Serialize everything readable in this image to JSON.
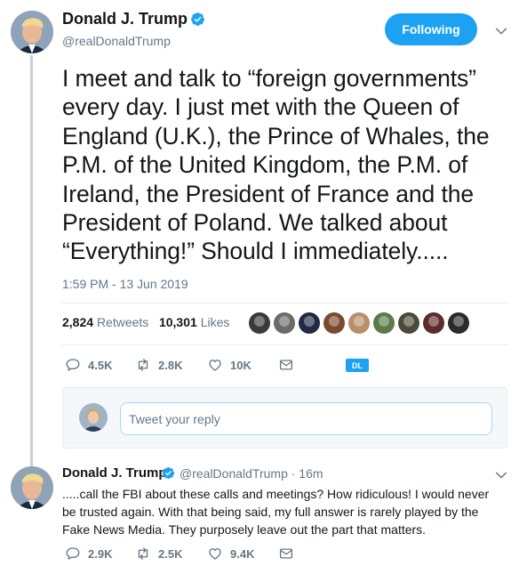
{
  "main_tweet": {
    "author_name": "Donald J. Trump",
    "handle": "@realDonaldTrump",
    "follow_label": "Following",
    "text": "I meet and talk to “foreign governments”\nevery day. I just met with the Queen of\nEngland (U.K.), the Prince of Whales, the\nP.M. of the United Kingdom, the P.M. of\nIreland, the President of France and the\nPresident of Poland. We talked about\n“Everything!” Should I immediately.....",
    "timestamp": "1:59 PM - 13 Jun 2019",
    "retweet_count": "2,824",
    "retweet_label": "Retweets",
    "like_count": "10,301",
    "like_label": "Likes",
    "liker_colors": [
      "#3a3a3a",
      "#6b6b6b",
      "#1f2a44",
      "#7a4a2e",
      "#b98e6a",
      "#5a7a4a",
      "#4a4a3a",
      "#5c2c2c",
      "#2b2b2b"
    ],
    "actions": {
      "replies": "4.5K",
      "retweets": "2.8K",
      "likes": "10K",
      "dl_label": "DL"
    }
  },
  "reply_box": {
    "placeholder": "Tweet your reply"
  },
  "reply_tweet": {
    "author_name": "Donald J. Trump",
    "meta": "@realDonaldTrump · 16m",
    "text": ".....call the FBI about these calls and meetings? How ridiculous! I would never\nbe trusted again. With that being said, my full answer is rarely played by the\nFake News Media. They purposely leave out the part that matters.",
    "actions": {
      "replies": "2.9K",
      "retweets": "2.5K",
      "likes": "9.4K"
    }
  },
  "colors": {
    "accent": "#1da1f2",
    "secondary_text": "#657786",
    "divider": "#e6ecf0"
  },
  "icons": [
    "verified-badge-icon",
    "chevron-down-icon",
    "reply-icon",
    "retweet-icon",
    "like-heart-icon",
    "message-icon"
  ]
}
